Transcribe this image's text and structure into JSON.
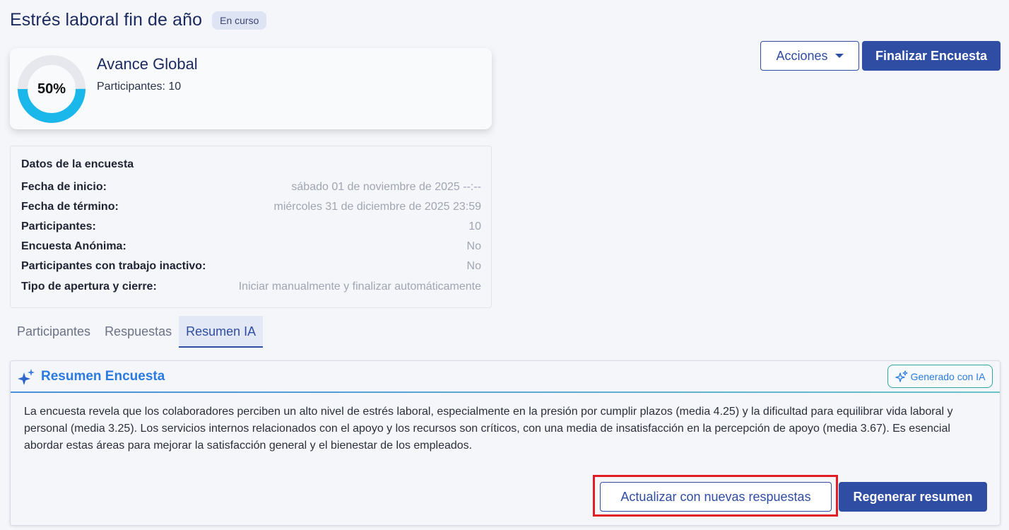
{
  "header": {
    "title": "Estrés laboral fin de año",
    "status": "En curso"
  },
  "actions": {
    "acciones_label": "Acciones",
    "finalizar_label": "Finalizar Encuesta"
  },
  "progress": {
    "percent_label": "50%",
    "percent_value": 0.5,
    "title": "Avance Global",
    "participants": "Participantes: 10",
    "ring_color": "#1ab7ea",
    "track_color": "#e6e8ee"
  },
  "survey_data": {
    "title": "Datos de la encuesta",
    "rows": [
      {
        "label": "Fecha de inicio:",
        "value": "sábado 01 de noviembre de 2025 --:--"
      },
      {
        "label": "Fecha de término:",
        "value": "miércoles 31 de diciembre de 2025 23:59"
      },
      {
        "label": "Participantes:",
        "value": "10"
      },
      {
        "label": "Encuesta Anónima:",
        "value": "No"
      },
      {
        "label": "Participantes con trabajo inactivo:",
        "value": "No"
      },
      {
        "label": "Tipo de apertura y cierre:",
        "value": "Iniciar manualmente y finalizar automáticamente"
      }
    ]
  },
  "tabs": [
    {
      "label": "Participantes",
      "active": false
    },
    {
      "label": "Respuestas",
      "active": false
    },
    {
      "label": "Resumen IA",
      "active": true
    }
  ],
  "summary": {
    "icon": "sparkle-icon",
    "title": "Resumen Encuesta",
    "ia_chip": "Generado con IA",
    "text": "La encuesta revela que los colaboradores perciben un alto nivel de estrés laboral, especialmente en la presión por cumplir plazos (media 4.25) y la dificultad para equilibrar vida laboral y personal (media 3.25). Los servicios internos relacionados con el apoyo y los recursos son críticos, con una media de insatisfacción en la percepción de apoyo (media 3.67). Es esencial abordar estas áreas para mejorar la satisfacción general y el bienestar de los empleados.",
    "update_label": "Actualizar con nuevas respuestas",
    "regenerate_label": "Regenerar resumen"
  },
  "colors": {
    "primary": "#2f4da3",
    "accent_blue": "#2a7be0",
    "highlight": "#e21c24"
  }
}
